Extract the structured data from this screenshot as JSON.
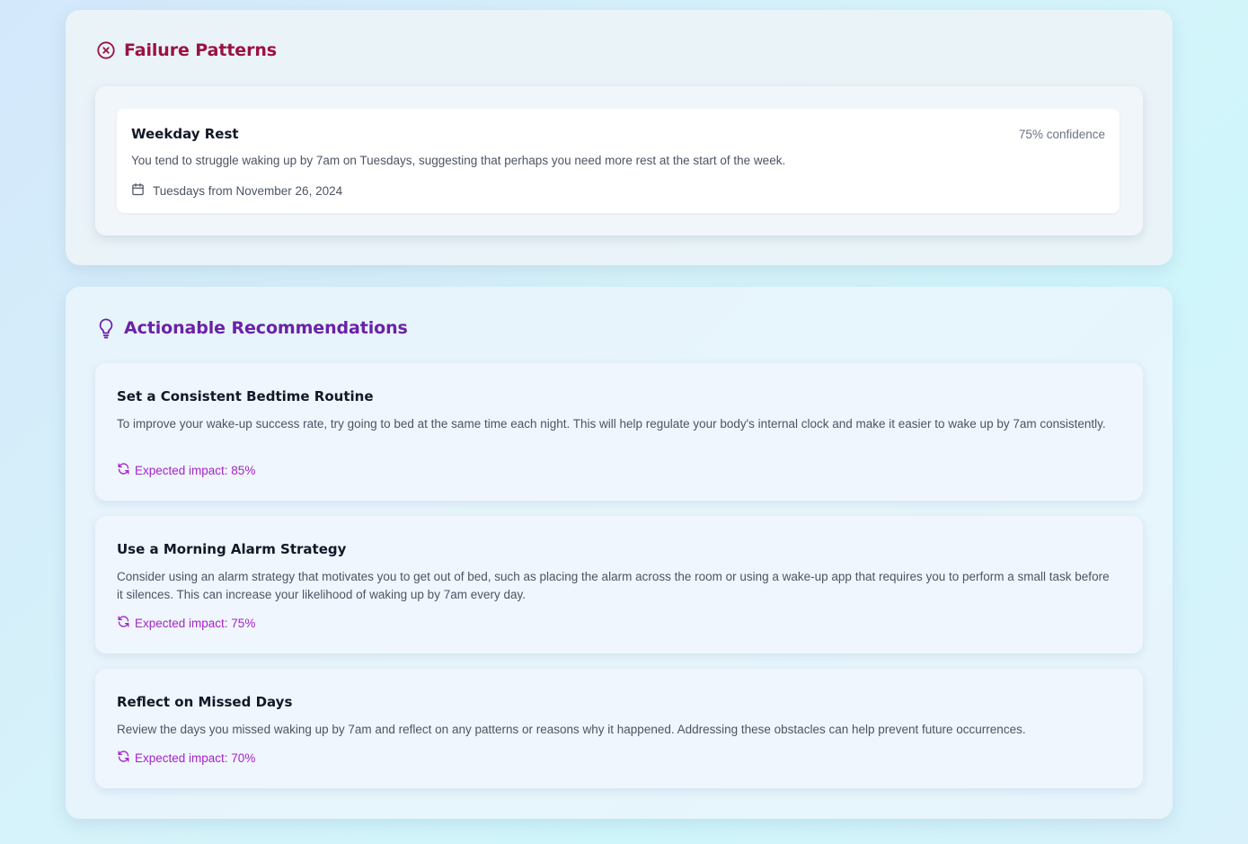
{
  "failure_patterns": {
    "title": "Failure Patterns",
    "icon": "x-circle-icon",
    "items": [
      {
        "title": "Weekday Rest",
        "confidence": "75% confidence",
        "description": "You tend to struggle waking up by 7am on Tuesdays, suggesting that perhaps you need more rest at the start of the week.",
        "date_icon": "calendar-icon",
        "dates": "Tuesdays from November 26, 2024"
      }
    ]
  },
  "recommendations": {
    "title": "Actionable Recommendations",
    "icon": "lightbulb-icon",
    "items": [
      {
        "title": "Set a Consistent Bedtime Routine",
        "description": "To improve your wake-up success rate, try going to bed at the same time each night. This will help regulate your body's internal clock and make it easier to wake up by 7am consistently.",
        "impact": "Expected impact: 85%"
      },
      {
        "title": "Use a Morning Alarm Strategy",
        "description": "Consider using an alarm strategy that motivates you to get out of bed, such as placing the alarm across the room or using a wake-up app that requires you to perform a small task before it silences. This can increase your likelihood of waking up by 7am every day.",
        "impact": "Expected impact: 75%"
      },
      {
        "title": "Reflect on Missed Days",
        "description": "Review the days you missed waking up by 7am and reflect on any patterns or reasons why it happened. Addressing these obstacles can help prevent future occurrences.",
        "impact": "Expected impact: 70%"
      }
    ],
    "impact_icon": "refresh-icon"
  },
  "colors": {
    "failure_accent": "#9b1240",
    "recommendation_accent": "#6b21a8",
    "impact_text": "#a524c8"
  }
}
